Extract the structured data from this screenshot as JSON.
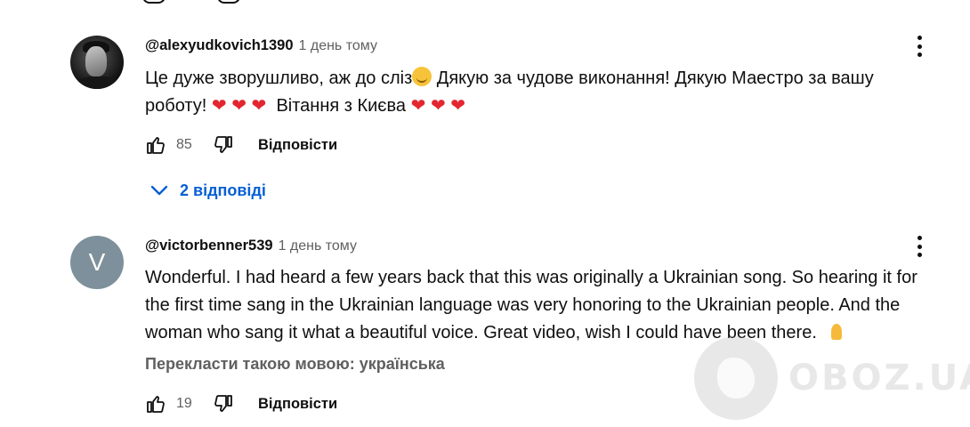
{
  "comments": [
    {
      "author": "@alexyudkovich1390",
      "time": "1 день тому",
      "avatar": "user-photo",
      "text_line1": "Це дуже зворушливо, аж до сліз",
      "text_line1_end": " Дякую за чудове виконання! Дякую Маестро за вашу",
      "text_line2": "роботу!",
      "text_line2_greeting": "Вітання з Києва",
      "likes": "85",
      "reply_label": "Відповісти",
      "replies_label": "2 відповіді"
    },
    {
      "author": "@victorbenner539",
      "time": "1 день тому",
      "avatar_letter": "V",
      "avatar_color": "#7d909b",
      "text": "Wonderful. I had heard a few years back that this was originally a Ukrainian song. So hearing it for the first time sang in the Ukrainian language was very honoring to the Ukrainian people. And the woman who sang it what a beautiful voice. Great video, wish I could have been there.",
      "translate_label": "Перекласти такою мовою: українська",
      "likes": "19",
      "reply_label": "Відповісти"
    }
  ],
  "icons": {
    "like": "thumbs-up-icon",
    "dislike": "thumbs-down-icon",
    "more": "more-vert-icon",
    "expand": "chevron-down-icon"
  },
  "colors": {
    "link": "#065fd4",
    "secondary_text": "#606060",
    "heart": "#e3262f"
  },
  "watermark": "OBOZ.UA"
}
